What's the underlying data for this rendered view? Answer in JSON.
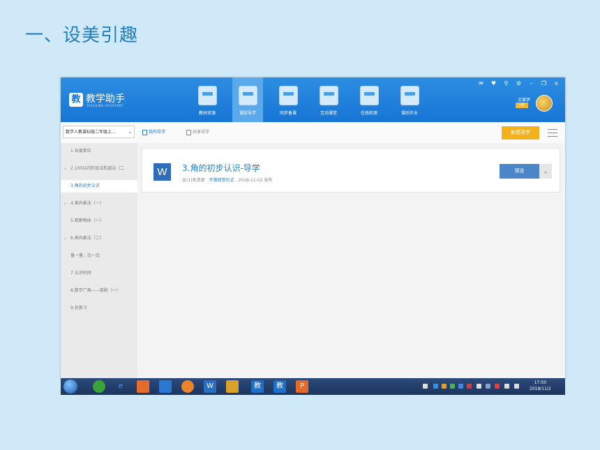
{
  "slide": {
    "title": "一、设美引趣"
  },
  "app": {
    "logo_char": "教",
    "name": "教学助手",
    "subtitle": "TEACHING ASSISTANT",
    "nav": [
      {
        "label": "教材资源",
        "icon": "textbook-icon",
        "active": false
      },
      {
        "label": "课前导学",
        "icon": "preview-guide-icon",
        "active": true
      },
      {
        "label": "同步备课",
        "icon": "lesson-prep-icon",
        "active": false
      },
      {
        "label": "互动课堂",
        "icon": "interactive-class-icon",
        "active": false
      },
      {
        "label": "在线检测",
        "icon": "online-test-icon",
        "active": false
      },
      {
        "label": "课后作业",
        "icon": "homework-icon",
        "active": false
      }
    ],
    "window_controls": [
      "✉",
      "♥",
      "⚲",
      "⚙",
      "–",
      "❐",
      "×"
    ],
    "user": {
      "name": "文爱伊",
      "badge": "VIP"
    }
  },
  "toolbar": {
    "grade_select": "数学人教课标版二年级上...",
    "tabs": [
      {
        "label": "我的导学",
        "active": true
      },
      {
        "label": "共享导学",
        "active": false
      }
    ],
    "new_button": "新建导学"
  },
  "sidebar": {
    "items": [
      {
        "label": "1.长度单位",
        "expandable": false,
        "active": false
      },
      {
        "label": "2.100以内的加法和减法（二",
        "expandable": true,
        "active": false
      },
      {
        "label": "3.角的初步认识",
        "expandable": false,
        "active": true
      },
      {
        "label": "4.表内乘法（一）",
        "expandable": true,
        "active": false
      },
      {
        "label": "5.观察物体（一）",
        "expandable": false,
        "active": false
      },
      {
        "label": "6.表内乘法（二）",
        "expandable": true,
        "active": false
      },
      {
        "label": "量一量，比一比",
        "expandable": false,
        "active": false
      },
      {
        "label": "7.认识时间",
        "expandable": false,
        "active": false
      },
      {
        "label": "8.数学广角——搭配（一）",
        "expandable": false,
        "active": false
      },
      {
        "label": "9.总复习",
        "expandable": false,
        "active": false
      }
    ]
  },
  "document": {
    "icon_letter": "W",
    "title": "3.角的初步认识-导学",
    "resources": "含(1)条资源",
    "form": "不限回答形式",
    "published": "2018-11-02 发布",
    "preview_button": "预览"
  },
  "taskbar": {
    "time": "17:50",
    "date": "2018/11/2"
  }
}
